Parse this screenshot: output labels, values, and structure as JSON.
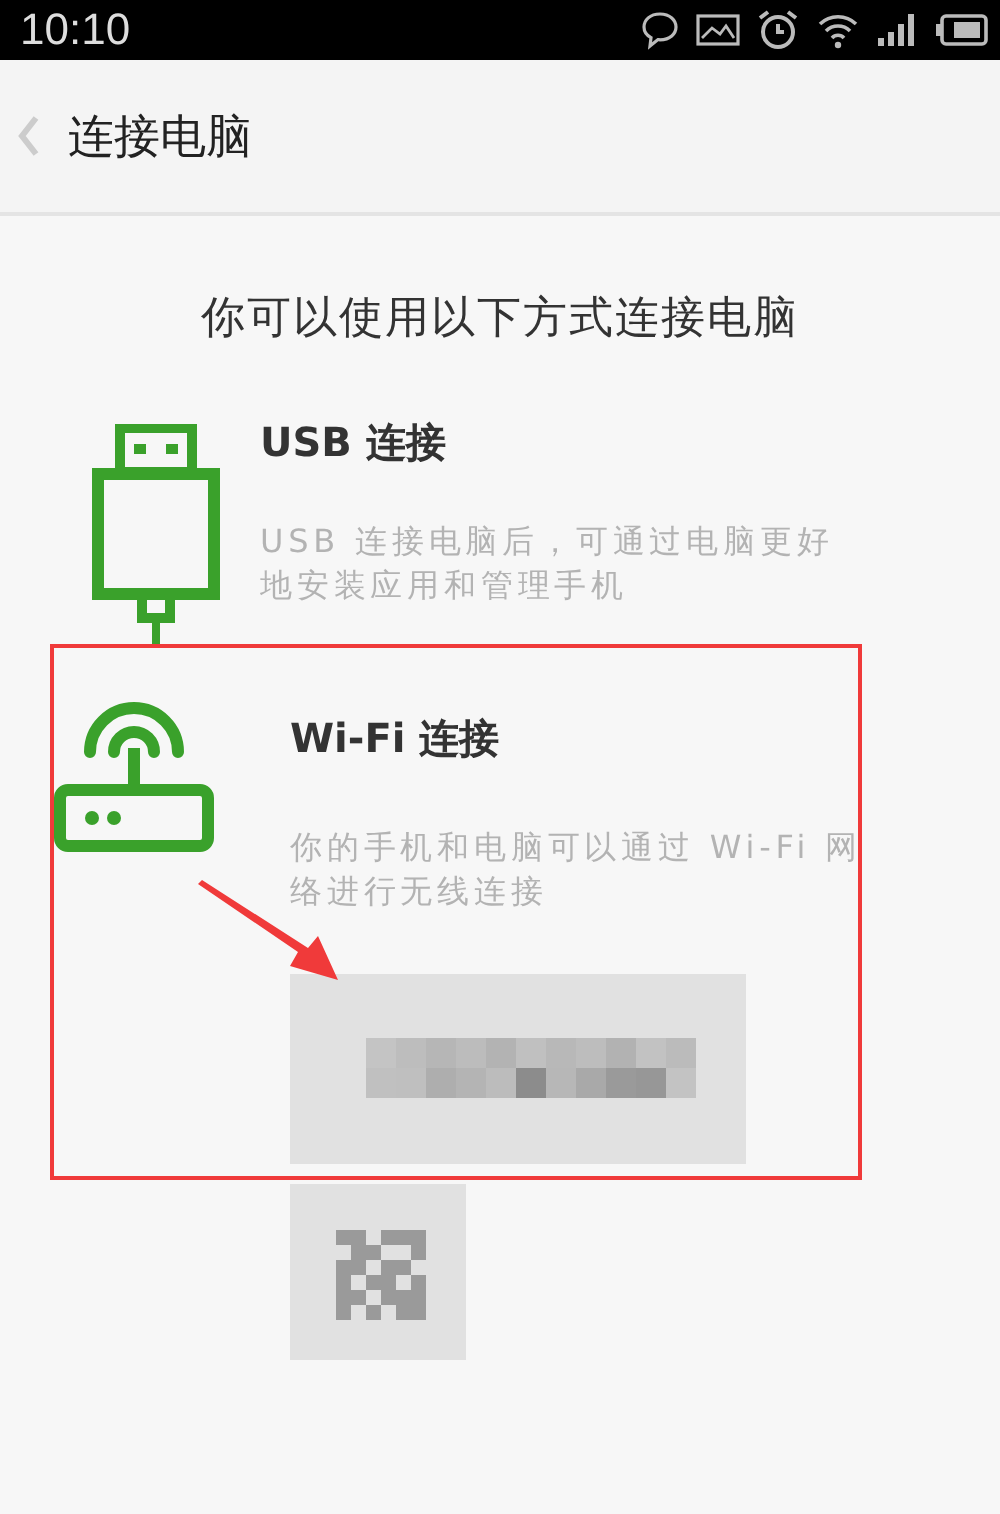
{
  "status_bar": {
    "time": "10:10"
  },
  "header": {
    "title": "连接电脑"
  },
  "heading": "你可以使用以下方式连接电脑",
  "methods": [
    {
      "kind": "usb",
      "title": "USB 连接",
      "description": "USB 连接电脑后，可通过电脑更好地安装应用和管理手机",
      "highlighted": false
    },
    {
      "kind": "wifi",
      "title": "Wi-Fi 连接",
      "description": "你的手机和电脑可以通过 Wi-Fi 网络进行无线连接",
      "highlighted": true,
      "extras": [
        {
          "kind": "blurred-text"
        },
        {
          "kind": "blurred-code"
        }
      ]
    }
  ]
}
